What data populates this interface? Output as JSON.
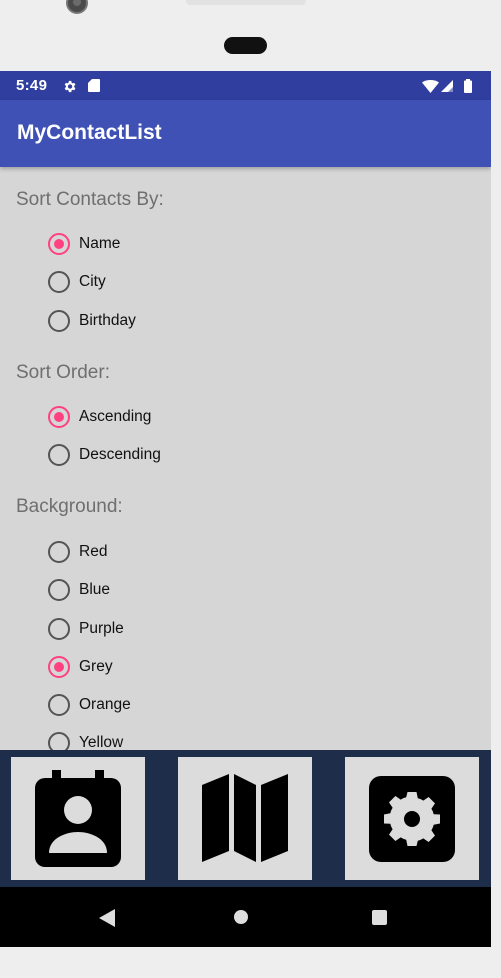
{
  "status_bar": {
    "time": "5:49",
    "icons": [
      "settings-icon",
      "sd-card-icon",
      "wifi-icon",
      "signal-icon",
      "battery-icon"
    ]
  },
  "app_bar": {
    "title": "MyContactList",
    "color": "#3f51b5"
  },
  "colors": {
    "status_bar": "#303f9f",
    "accent": "#ff4081",
    "screen_background": "#d6d6d6",
    "bottom_bar": "#1e2d4a"
  },
  "sections": {
    "sort_by": {
      "title": "Sort Contacts By:",
      "options": [
        {
          "label": "Name",
          "checked": true
        },
        {
          "label": "City",
          "checked": false
        },
        {
          "label": "Birthday",
          "checked": false
        }
      ]
    },
    "sort_order": {
      "title": "Sort Order:",
      "options": [
        {
          "label": "Ascending",
          "checked": true
        },
        {
          "label": "Descending",
          "checked": false
        }
      ]
    },
    "background": {
      "title": "Background:",
      "options": [
        {
          "label": "Red",
          "checked": false
        },
        {
          "label": "Blue",
          "checked": false
        },
        {
          "label": "Purple",
          "checked": false
        },
        {
          "label": "Grey",
          "checked": true
        },
        {
          "label": "Orange",
          "checked": false
        },
        {
          "label": "Yellow",
          "checked": false
        }
      ]
    }
  },
  "bottom_nav": {
    "buttons": [
      {
        "icon": "contact-list-icon"
      },
      {
        "icon": "map-icon"
      },
      {
        "icon": "settings-gear-icon"
      }
    ]
  },
  "system_nav": {
    "icons": [
      "back-icon",
      "home-icon",
      "recents-icon"
    ]
  }
}
